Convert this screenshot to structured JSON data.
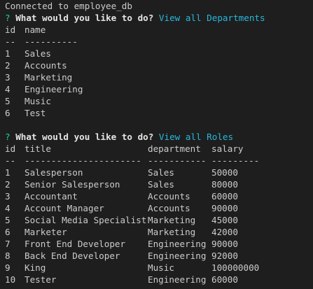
{
  "terminal": {
    "connected_message": "Connected to employee_db"
  },
  "prompt1": {
    "mark": "?",
    "question": "What would you like to do?",
    "answer": "View all Departments"
  },
  "departments": {
    "headers": [
      "id",
      "name"
    ],
    "separators": [
      "--",
      "----------"
    ],
    "rows": [
      {
        "id": "1",
        "name": "Sales"
      },
      {
        "id": "2",
        "name": "Accounts"
      },
      {
        "id": "3",
        "name": "Marketing"
      },
      {
        "id": "4",
        "name": "Engineering"
      },
      {
        "id": "5",
        "name": "Music"
      },
      {
        "id": "6",
        "name": "Test"
      }
    ]
  },
  "prompt2": {
    "mark": "?",
    "question": "What would you like to do?",
    "answer": "View all Roles"
  },
  "roles": {
    "headers": [
      "id",
      "title",
      "department",
      "salary"
    ],
    "separators": [
      "--",
      "----------------------",
      "-----------",
      "---------"
    ],
    "rows": [
      {
        "id": "1",
        "title": "Salesperson",
        "department": "Sales",
        "salary": "50000"
      },
      {
        "id": "2",
        "title": "Senior Salesperson",
        "department": "Sales",
        "salary": "80000"
      },
      {
        "id": "3",
        "title": "Accountant",
        "department": "Accounts",
        "salary": "60000"
      },
      {
        "id": "4",
        "title": "Account Manager",
        "department": "Accounts",
        "salary": "90000"
      },
      {
        "id": "5",
        "title": "Social Media Specialist",
        "department": "Marketing",
        "salary": "45000"
      },
      {
        "id": "6",
        "title": "Marketer",
        "department": "Marketing",
        "salary": "42000"
      },
      {
        "id": "7",
        "title": "Front End Developer",
        "department": "Engineering",
        "salary": "90000"
      },
      {
        "id": "8",
        "title": "Back End Developer",
        "department": "Engineering",
        "salary": "92000"
      },
      {
        "id": "9",
        "title": "King",
        "department": "Music",
        "salary": "100000000"
      },
      {
        "id": "10",
        "title": "Tester",
        "department": "Engineering",
        "salary": "60000"
      }
    ]
  },
  "colors": {
    "background": "#1e1e1e",
    "text": "#cccccc",
    "prompt_mark": "#23d18b",
    "answer": "#29b8db"
  }
}
